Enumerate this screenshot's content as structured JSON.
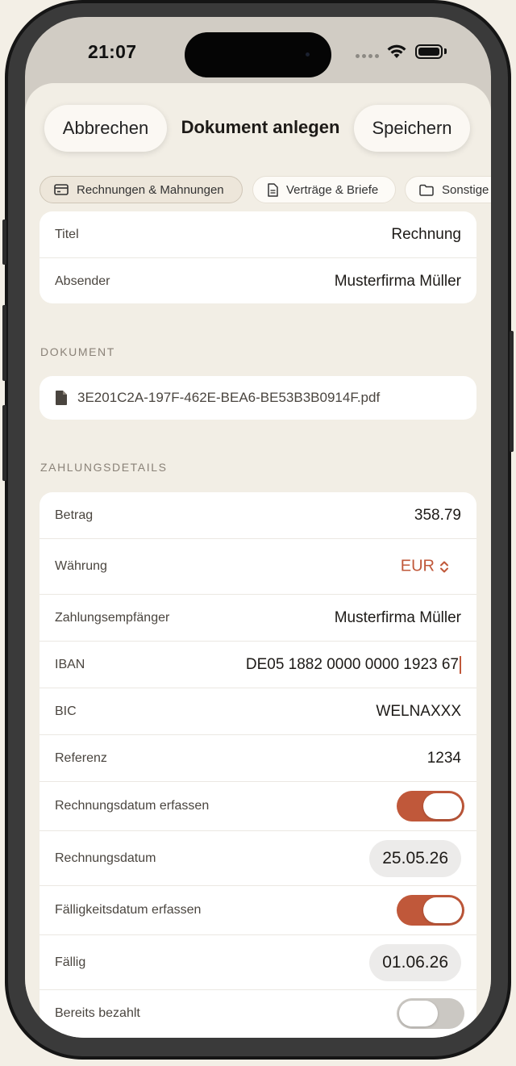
{
  "status_bar": {
    "time": "21:07"
  },
  "nav": {
    "cancel_label": "Abbrechen",
    "title": "Dokument anlegen",
    "save_label": "Speichern"
  },
  "categories": [
    {
      "label": "Rechnungen & Mahnungen",
      "icon": "card-icon",
      "selected": true
    },
    {
      "label": "Verträge & Briefe",
      "icon": "document-icon",
      "selected": false
    },
    {
      "label": "Sonstige",
      "icon": "folder-icon",
      "selected": false
    }
  ],
  "general": {
    "title_label": "Titel",
    "title_value": "Rechnung",
    "sender_label": "Absender",
    "sender_value": "Musterfirma Müller"
  },
  "document_section": {
    "header": "DOKUMENT",
    "file_name": "3E201C2A-197F-462E-BEA6-BE53B3B0914F.pdf"
  },
  "payment": {
    "header": "ZAHLUNGSDETAILS",
    "amount_label": "Betrag",
    "amount_value": "358.79",
    "currency_label": "Währung",
    "currency_value": "EUR",
    "payee_label": "Zahlungsempfänger",
    "payee_value": "Musterfirma Müller",
    "iban_label": "IBAN",
    "iban_value": "DE05 1882 0000 0000 1923 67",
    "bic_label": "BIC",
    "bic_value": "WELNAXXX",
    "reference_label": "Referenz",
    "reference_value": "1234",
    "invoice_date_toggle_label": "Rechnungsdatum erfassen",
    "invoice_date_toggle_on": true,
    "invoice_date_label": "Rechnungsdatum",
    "invoice_date_value": "25.05.26",
    "due_date_toggle_label": "Fälligkeitsdatum erfassen",
    "due_date_toggle_on": true,
    "due_label": "Fällig",
    "due_value": "01.06.26",
    "paid_label": "Bereits bezahlt",
    "paid_on": false
  },
  "colors": {
    "accent": "#c0583a",
    "background": "#f2eee5",
    "card": "#ffffff",
    "toggle_off": "#cbc8c3"
  }
}
